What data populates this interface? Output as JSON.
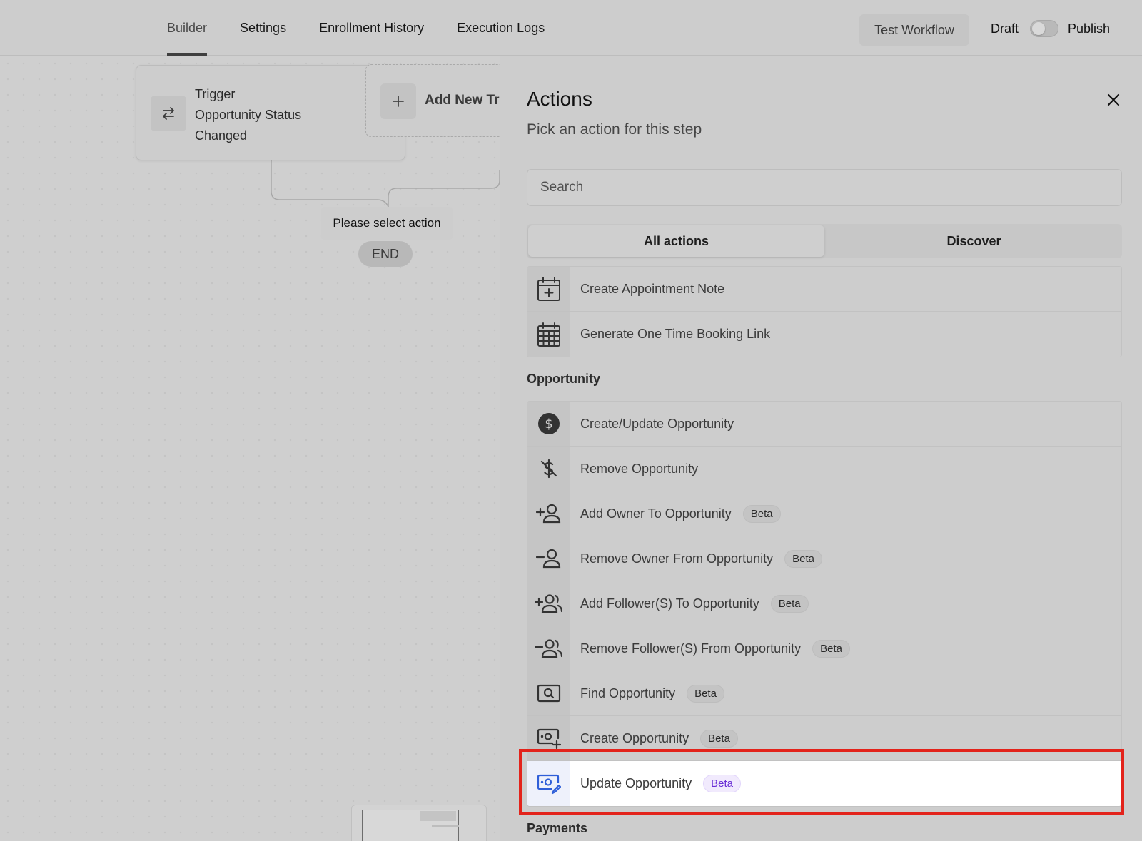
{
  "topbar": {
    "tabs": [
      {
        "label": "Builder",
        "active": true
      },
      {
        "label": "Settings",
        "active": false
      },
      {
        "label": "Enrollment History",
        "active": false
      },
      {
        "label": "Execution Logs",
        "active": false
      }
    ],
    "test_button": "Test Workflow",
    "draft_label": "Draft",
    "publish_label": "Publish",
    "publish_toggle_on": false
  },
  "canvas": {
    "trigger": {
      "title": "Trigger",
      "name_line1": "Opportunity Status",
      "name_line2": "Changed",
      "icon": "swap-arrows-icon"
    },
    "add_trigger_label": "Add New Tr",
    "placeholder_action": "Please select action",
    "end_label": "END"
  },
  "panel": {
    "title": "Actions",
    "subtitle": "Pick an action for this step",
    "search_placeholder": "Search",
    "segments": [
      {
        "label": "All actions",
        "active": true
      },
      {
        "label": "Discover",
        "active": false
      }
    ],
    "appointment_items": [
      {
        "label": "Create Appointment Note",
        "icon": "calendar-plus-icon",
        "beta": ""
      },
      {
        "label": "Generate One Time Booking Link",
        "icon": "calendar-grid-icon",
        "beta": ""
      }
    ],
    "opportunity_section": "Opportunity",
    "opportunity_items": [
      {
        "label": "Create/Update Opportunity",
        "icon": "dollar-circle-icon",
        "beta": ""
      },
      {
        "label": "Remove Opportunity",
        "icon": "dollar-off-icon",
        "beta": ""
      },
      {
        "label": "Add Owner To Opportunity",
        "icon": "user-plus-icon",
        "beta": "Beta"
      },
      {
        "label": "Remove Owner From Opportunity",
        "icon": "user-minus-icon",
        "beta": "Beta"
      },
      {
        "label": "Add Follower(S) To Opportunity",
        "icon": "users-plus-icon",
        "beta": "Beta"
      },
      {
        "label": "Remove Follower(S) From Opportunity",
        "icon": "users-minus-icon",
        "beta": "Beta"
      },
      {
        "label": "Find Opportunity",
        "icon": "search-money-icon",
        "beta": "Beta"
      },
      {
        "label": "Create Opportunity",
        "icon": "money-plus-icon",
        "beta": "Beta"
      },
      {
        "label": "Update Opportunity",
        "icon": "money-edit-icon",
        "beta": "Beta",
        "highlighted": true
      }
    ],
    "payments_section": "Payments"
  },
  "colors": {
    "highlight_border": "#e3231b",
    "beta_accent": "#6a2fd6",
    "icon_accent": "#2f5fd8"
  }
}
